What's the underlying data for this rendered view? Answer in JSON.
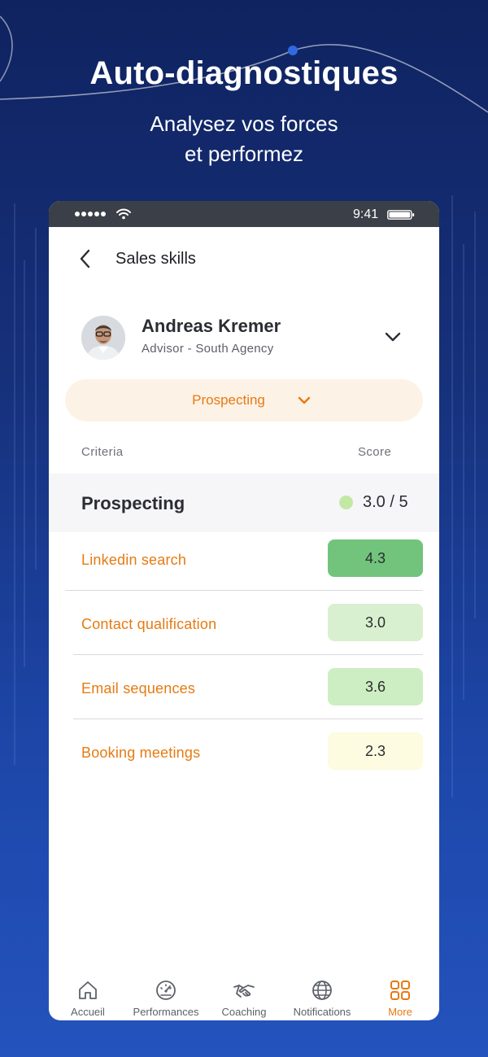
{
  "promo": {
    "headline": "Auto-diagnostiques",
    "subtitle_line1": "Analysez vos forces",
    "subtitle_line2": "et performez"
  },
  "status_bar": {
    "time": "9:41",
    "icons": [
      "signal-dots-icon",
      "wifi-icon",
      "battery-icon"
    ]
  },
  "header": {
    "title": "Sales skills",
    "back_icon": "chevron-left-icon"
  },
  "profile": {
    "name": "Andreas Kremer",
    "role": "Advisor - South Agency",
    "toggle_icon": "chevron-down-icon"
  },
  "category_selector": {
    "selected": "Prospecting",
    "icon": "chevron-down-icon"
  },
  "table": {
    "criteria_header": "Criteria",
    "score_header": "Score",
    "group": {
      "title": "Prospecting",
      "score": "3.0 / 5",
      "dot_color": "#c3e8a6"
    },
    "rows": [
      {
        "label": "Linkedin search",
        "score": "4.3",
        "chip_color": "#72c47c"
      },
      {
        "label": "Contact qualification",
        "score": "3.0",
        "chip_color": "#d8f0cf"
      },
      {
        "label": "Email sequences",
        "score": "3.6",
        "chip_color": "#cdeec2"
      },
      {
        "label": "Booking meetings",
        "score": "2.3",
        "chip_color": "#fdfbe0"
      }
    ]
  },
  "tabbar": {
    "tabs": [
      {
        "label": "Accueil",
        "icon": "home-icon",
        "active": false
      },
      {
        "label": "Performances",
        "icon": "gauge-icon",
        "active": false
      },
      {
        "label": "Coaching",
        "icon": "handshake-icon",
        "active": false
      },
      {
        "label": "Notifications",
        "icon": "globe-icon",
        "active": false
      },
      {
        "label": "More",
        "icon": "grid-icon",
        "active": true
      }
    ]
  },
  "colors": {
    "accent": "#e67a12",
    "background_top": "#0f2360",
    "background_bottom": "#2453bd",
    "status_bar": "#3b3f47"
  }
}
